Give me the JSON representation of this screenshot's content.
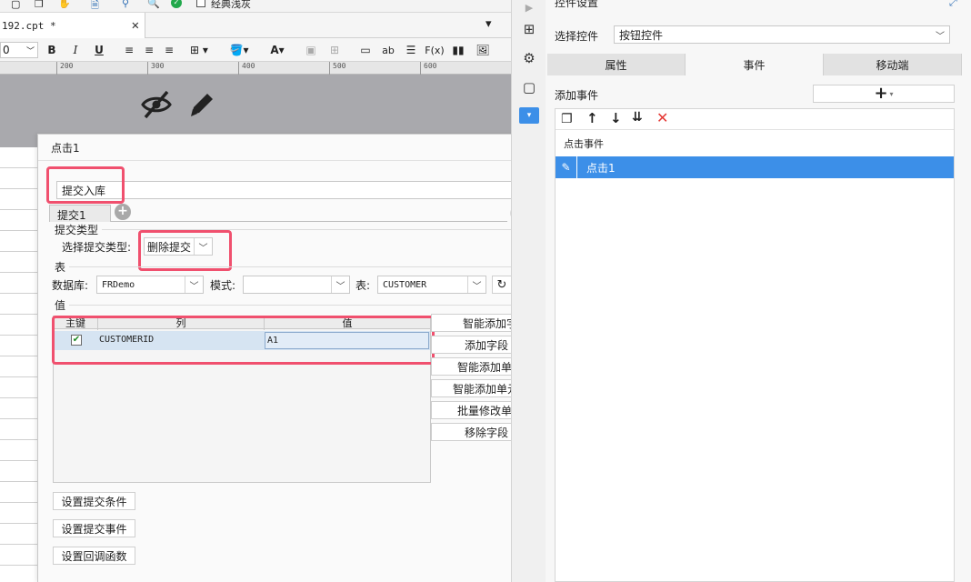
{
  "editor": {
    "toolbar_top_label": "经典浅灰",
    "doc_tab_title": "192.cpt *",
    "font_size_value": "0",
    "ruler_ticks": [
      "200",
      "300",
      "400",
      "500",
      "600"
    ]
  },
  "dialog": {
    "title": "点击1",
    "event_type": "提交入库",
    "submit_tab": "提交1",
    "section_submit_type": "提交类型",
    "submit_type_label": "选择提交类型:",
    "submit_type_value": "删除提交",
    "section_table": "表",
    "database_label": "数据库:",
    "database_value": "FRDemo",
    "mode_label": "模式:",
    "mode_value": "",
    "table_label": "表:",
    "table_value": "CUSTOMER",
    "section_value": "值",
    "columns": {
      "key": "主键",
      "column": "列",
      "value": "值"
    },
    "rows": [
      {
        "checked": true,
        "column": "CUSTOMERID",
        "value": "A1"
      }
    ],
    "side_buttons": [
      "智能添加字段",
      "添加字段",
      "智能添加单元格",
      "智能添加单元格组",
      "批量修改单元格",
      "移除字段"
    ],
    "bottom_buttons": [
      "设置提交条件",
      "设置提交事件",
      "设置回调函数"
    ]
  },
  "panel": {
    "title": "控件设置",
    "select_widget_label": "选择控件",
    "select_widget_value": "按钮控件",
    "tabs": [
      "属性",
      "事件",
      "移动端"
    ],
    "active_tab": "事件",
    "add_event_label": "添加事件",
    "add_event_button": "+",
    "event_group": "点击事件",
    "events": [
      "点击1"
    ]
  },
  "colors": {
    "highlight_red": "#f0506e",
    "selected_blue": "#3c8fe8",
    "delete_red": "#e53935",
    "check_green": "#1f8b24"
  }
}
